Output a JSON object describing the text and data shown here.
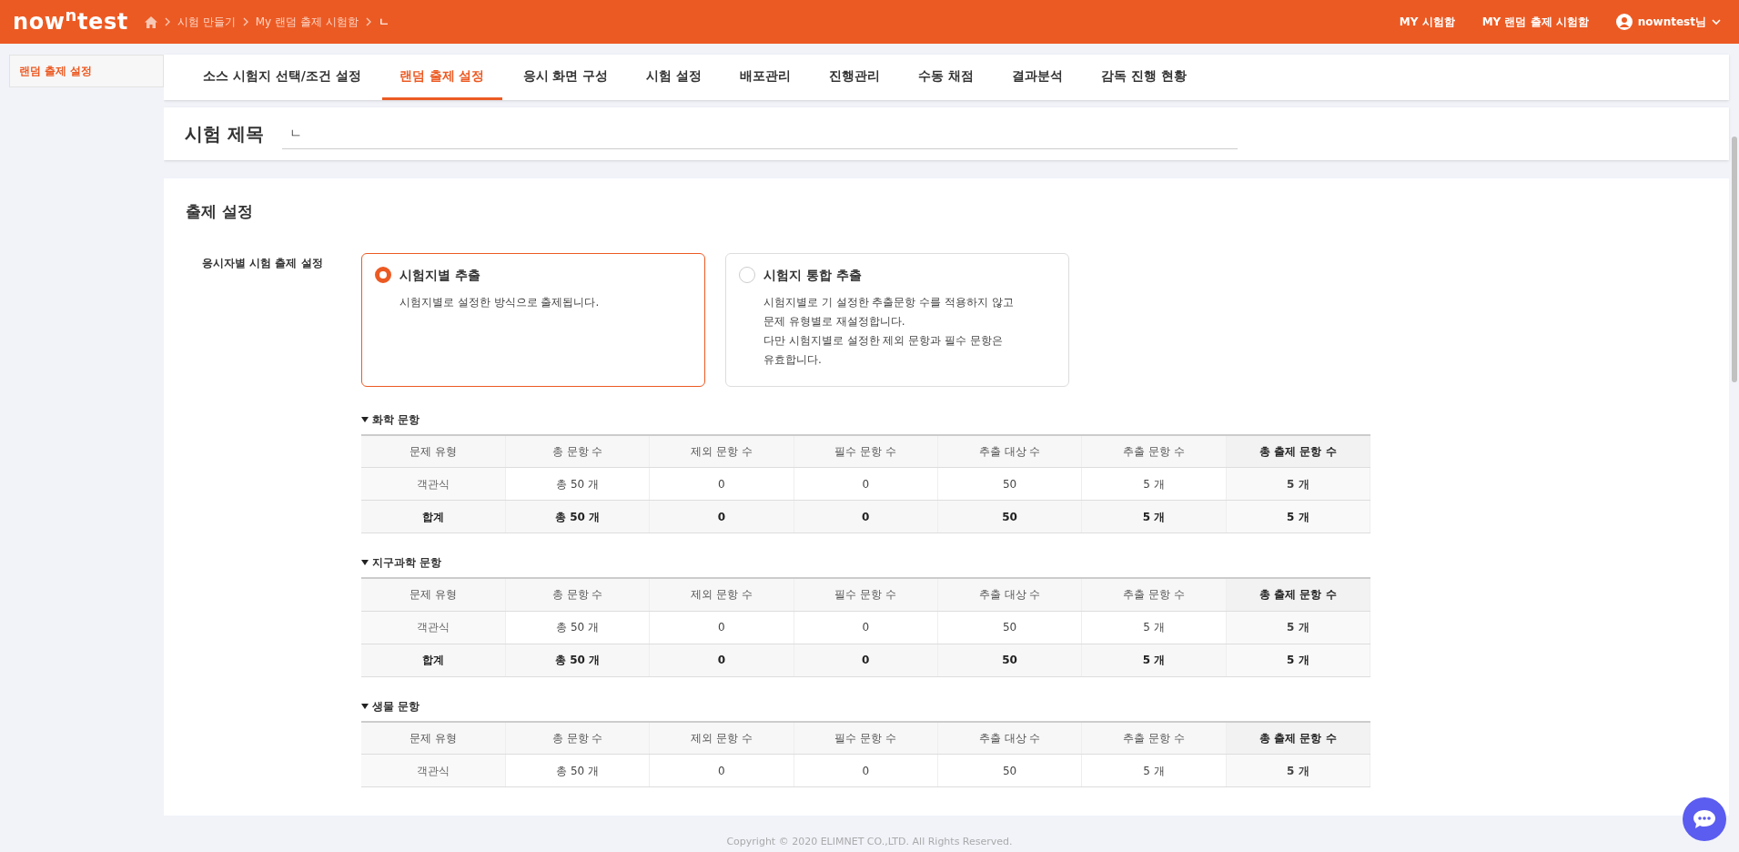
{
  "header": {
    "logo": "now$^{n}$test",
    "breadcrumb": [
      "시험 만들기",
      "My 랜덤 출제 시험함",
      "ㄴ"
    ],
    "links": [
      "MY 시험함",
      "MY 랜덤 출제 시험함"
    ],
    "user": "nowntest님"
  },
  "sidebar": {
    "items": [
      {
        "label": "랜덤 출제 설정",
        "selected": true
      }
    ]
  },
  "tabs": [
    {
      "label": "소스 시험지 선택/조건 설정",
      "selected": false
    },
    {
      "label": "랜덤 출제 설정",
      "selected": true
    },
    {
      "label": "응시 화면 구성",
      "selected": false
    },
    {
      "label": "시험 설정",
      "selected": false
    },
    {
      "label": "배포관리",
      "selected": false
    },
    {
      "label": "진행관리",
      "selected": false
    },
    {
      "label": "수동 채점",
      "selected": false
    },
    {
      "label": "결과분석",
      "selected": false
    },
    {
      "label": "감독 진행 현황",
      "selected": false
    }
  ],
  "exam_title": {
    "label": "시험 제목",
    "value": "ㄴ"
  },
  "settings": {
    "title": "출제 설정",
    "field_label": "응시자별 시험 출제 설정",
    "options": [
      {
        "title": "시험지별 추출",
        "description": "시험지별로 설정한 방식으로 출제됩니다.",
        "selected": true
      },
      {
        "title": "시험지 통합 추출",
        "description": "시험지별로 기 설정한 추출문항 수를 적용하지 않고\n문제 유형별로 재설정합니다.\n다만 시험지별로 설정한 제외 문항과 필수 문항은\n유효합니다.",
        "selected": false
      }
    ]
  },
  "sections": [
    {
      "title": "화학 문항",
      "expanded": true,
      "columns": [
        "문제 유형",
        "총 문항 수",
        "제외 문항 수",
        "필수 문항 수",
        "추출 대상 수",
        "추출 문항 수",
        "총 출제 문항 수"
      ],
      "rows": [
        {
          "kind": "data",
          "cells": [
            "객관식",
            "총 50 개",
            "0",
            "0",
            "50",
            "5 개",
            "5 개"
          ]
        },
        {
          "kind": "total",
          "cells": [
            "합계",
            "총 50 개",
            "0",
            "0",
            "50",
            "5 개",
            "5 개"
          ]
        }
      ]
    },
    {
      "title": "지구과학 문항",
      "expanded": true,
      "columns": [
        "문제 유형",
        "총 문항 수",
        "제외 문항 수",
        "필수 문항 수",
        "추출 대상 수",
        "추출 문항 수",
        "총 출제 문항 수"
      ],
      "rows": [
        {
          "kind": "data",
          "cells": [
            "객관식",
            "총 50 개",
            "0",
            "0",
            "50",
            "5 개",
            "5 개"
          ]
        },
        {
          "kind": "total",
          "cells": [
            "합계",
            "총 50 개",
            "0",
            "0",
            "50",
            "5 개",
            "5 개"
          ]
        }
      ]
    },
    {
      "title": "생물 문항",
      "expanded": true,
      "columns": [
        "문제 유형",
        "총 문항 수",
        "제외 문항 수",
        "필수 문항 수",
        "추출 대상 수",
        "추출 문항 수",
        "총 출제 문항 수"
      ],
      "rows": [
        {
          "kind": "data",
          "cells": [
            "객관식",
            "총 50 개",
            "0",
            "0",
            "50",
            "5 개",
            "5 개"
          ]
        }
      ]
    }
  ],
  "footer": "Copyright © 2020 ELIMNET CO.,LTD. All Rights Reserved."
}
